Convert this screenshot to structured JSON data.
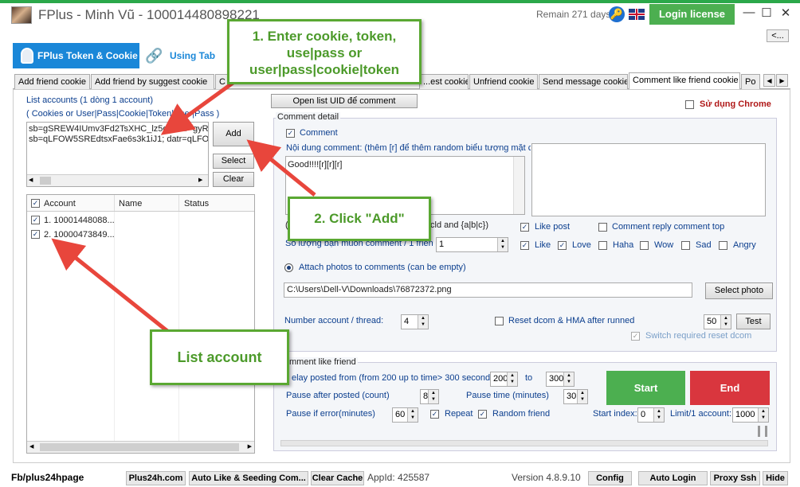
{
  "window": {
    "title": "FPlus - Minh Vũ - 100014480898221",
    "remain": "Remain 271 days",
    "login_license": "Login license",
    "minimize": "—",
    "maximize": "☐",
    "close": "✕",
    "collapse_btn": "<..."
  },
  "main_tabs": [
    {
      "label": "FPlus Token & Cookie",
      "icon": "shield-icon"
    },
    {
      "label": "Using Tab",
      "icon": "link-icon"
    }
  ],
  "sub_tabs": [
    "Add friend cookie",
    "Add friend by suggest cookie",
    "C",
    "...est cookie",
    "Unfriend cookie",
    "Send message cookie",
    "Comment like friend cookie",
    "Po"
  ],
  "left": {
    "list_label": "List accounts (1 dòng 1 account)",
    "format_label": "( Cookies or User|Pass|Cookie|Token|User|Pass )",
    "account_lines": [
      "sb=gSREW4IUmv3Fd2TsXHC_lz5o; datr=gyRE",
      "sb=qLFOW5SREdtsxFae6s3k1iJ1; datr=qLFOW"
    ],
    "add": "Add",
    "select": "Select",
    "clear": "Clear",
    "grid_headers": [
      "Account",
      "Name",
      "Status"
    ],
    "rows": [
      "1. 10001448088...",
      "2. 10000473849..."
    ]
  },
  "right": {
    "open_list": "Open list UID để comment",
    "use_chrome": "Sử dụng Chrome",
    "comment_detail": "Comment detail",
    "comment_chk": "Comment",
    "content_label": "Nội dung comment: (thêm [r] để thêm random biểu tượng mặt cười",
    "content_value": "Good!!!![r][r][r]",
    "spin_note_left": "(C",
    "spin_note_right": "cld and {a|b|c})",
    "amount_label": "Số lượng bạn muốn comment / 1 friend",
    "amount_value": "1",
    "like_post": "Like post",
    "reply_top": "Comment reply comment top",
    "reactions": [
      "Like",
      "Love",
      "Haha",
      "Wow",
      "Sad",
      "Angry"
    ],
    "attach_label": "Attach photos to comments (can be empty)",
    "photo_path": "C:\\Users\\Dell-V\\Downloads\\76872372.png",
    "select_photo": "Select photo",
    "num_thread_label": "Number account / thread:",
    "num_thread_value": "4",
    "reset_dcom": "Reset dcom & HMA after runned",
    "reset_value": "50",
    "test": "Test",
    "switch_reset": "Switch required reset dcom"
  },
  "clf": {
    "title": "mment like friend",
    "delay_label": "elay posted from (from 200 up to time> 300 seconds)",
    "delay_from": "200",
    "to": "to",
    "delay_to": "300",
    "pause_after_label": "Pause after posted (count)",
    "pause_after": "8",
    "pause_time_label": "Pause time (minutes)",
    "pause_time": "30",
    "pause_err_label": "Pause if error(minutes)",
    "pause_err": "60",
    "repeat": "Repeat",
    "random_friend": "Random friend",
    "start_index_label": "Start index:",
    "start_index": "0",
    "limit_label": "Limit/1 account:",
    "limit": "1000",
    "start": "Start",
    "end": "End"
  },
  "callouts": {
    "c1": "1. Enter cookie, token, use|pass or user|pass|cookie|token",
    "c2": "2. Click \"Add\"",
    "c3": "List account"
  },
  "status": {
    "page": "Fb/plus24hpage",
    "buttons": [
      "Plus24h.com",
      "Auto Like & Seeding Com...",
      "Clear Cache"
    ],
    "appid": "AppId: 425587",
    "version": "Version 4.8.9.10",
    "right_buttons": [
      "Config",
      "Auto Login",
      "Proxy Ssh",
      "Hide"
    ]
  },
  "colors": {
    "accent": "#1a87d8",
    "start": "#4caf50",
    "end": "#d9363e",
    "callout": "#5aa832",
    "arrow": "#e8463c"
  }
}
